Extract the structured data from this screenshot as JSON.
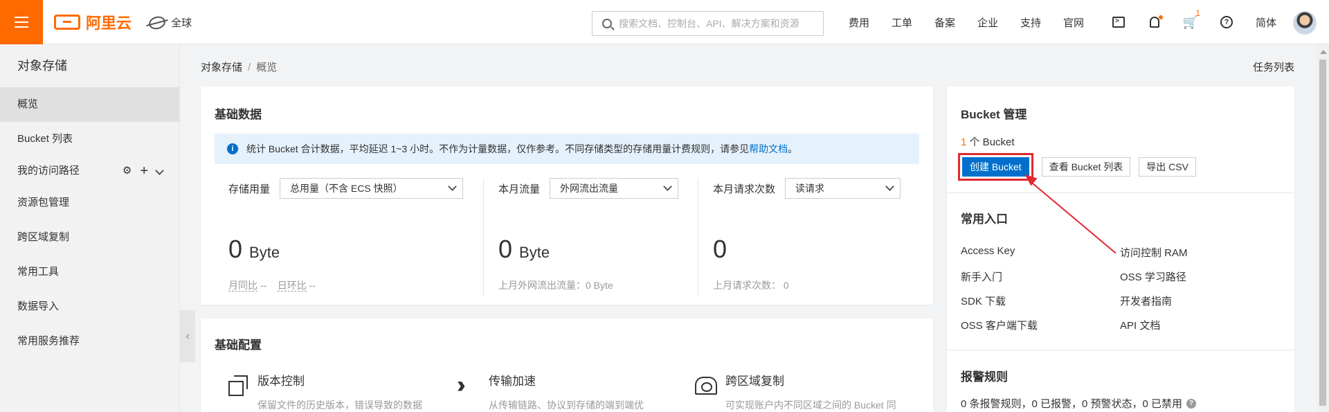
{
  "brand": {
    "logo_text": "阿里云",
    "accent": "#ff6a00"
  },
  "topbar": {
    "region": "全球",
    "search_placeholder": "搜索文档、控制台、API、解决方案和资源",
    "links": [
      "费用",
      "工单",
      "备案",
      "企业",
      "支持",
      "官网"
    ],
    "cart_badge": "1",
    "language": "简体"
  },
  "sidebar": {
    "title": "对象存储",
    "items": [
      {
        "label": "概览",
        "active": true
      },
      {
        "label": "Bucket 列表"
      },
      {
        "label": "我的访问路径"
      },
      {
        "label": "资源包管理"
      },
      {
        "label": "跨区域复制"
      },
      {
        "label": "常用工具"
      },
      {
        "label": "数据导入"
      },
      {
        "label": "常用服务推荐"
      }
    ]
  },
  "breadcrumb": {
    "root": "对象存储",
    "separator": "/",
    "current": "概览"
  },
  "task_list": "任务列表",
  "basic_data": {
    "title": "基础数据",
    "notice": {
      "text": "统计 Bucket 合计数据，平均延迟 1~3 小时。不作为计量数据，仅作参考。不同存储类型的存储用量计费规则，请参见",
      "link": "帮助文档",
      "end": "。"
    },
    "storage": {
      "label": "存储用量",
      "select": "总用量（不含 ECS 快照）",
      "value": "0",
      "unit": "Byte",
      "mom_label": "月同比",
      "mom_value": "--",
      "dod_label": "日环比",
      "dod_value": "--"
    },
    "traffic": {
      "label": "本月流量",
      "select": "外网流出流量",
      "value": "0",
      "unit": "Byte",
      "sub": "上月外网流出流量：0 Byte"
    },
    "requests": {
      "label": "本月请求次数",
      "select": "读请求",
      "value": "0",
      "sub": "上月请求次数：  0"
    }
  },
  "basic_config": {
    "title": "基础配置",
    "features": [
      {
        "title": "版本控制",
        "desc": "保留文件的历史版本，错误导致的数据"
      },
      {
        "title": "传输加速",
        "desc": "从传输链路、协议到存储的端到端优"
      },
      {
        "title": "跨区域复制",
        "desc": "可实现账户内不同区域之间的 Bucket 同"
      }
    ]
  },
  "bucket_mgmt": {
    "title": "Bucket 管理",
    "count": "1",
    "count_suffix": "个 Bucket",
    "create_btn": "创建 Bucket",
    "view_btn": "查看 Bucket 列表",
    "export_btn": "导出 CSV"
  },
  "common_entries": {
    "title": "常用入口",
    "items": [
      "Access Key",
      "访问控制 RAM",
      "新手入门",
      "OSS 学习路径",
      "SDK 下载",
      "开发者指南",
      "OSS 客户端下载",
      "API 文档"
    ]
  },
  "alert_rules": {
    "title": "报警规则",
    "summary": "0 条报警规则，0 已报警，0 预警状态，0 已禁用"
  }
}
